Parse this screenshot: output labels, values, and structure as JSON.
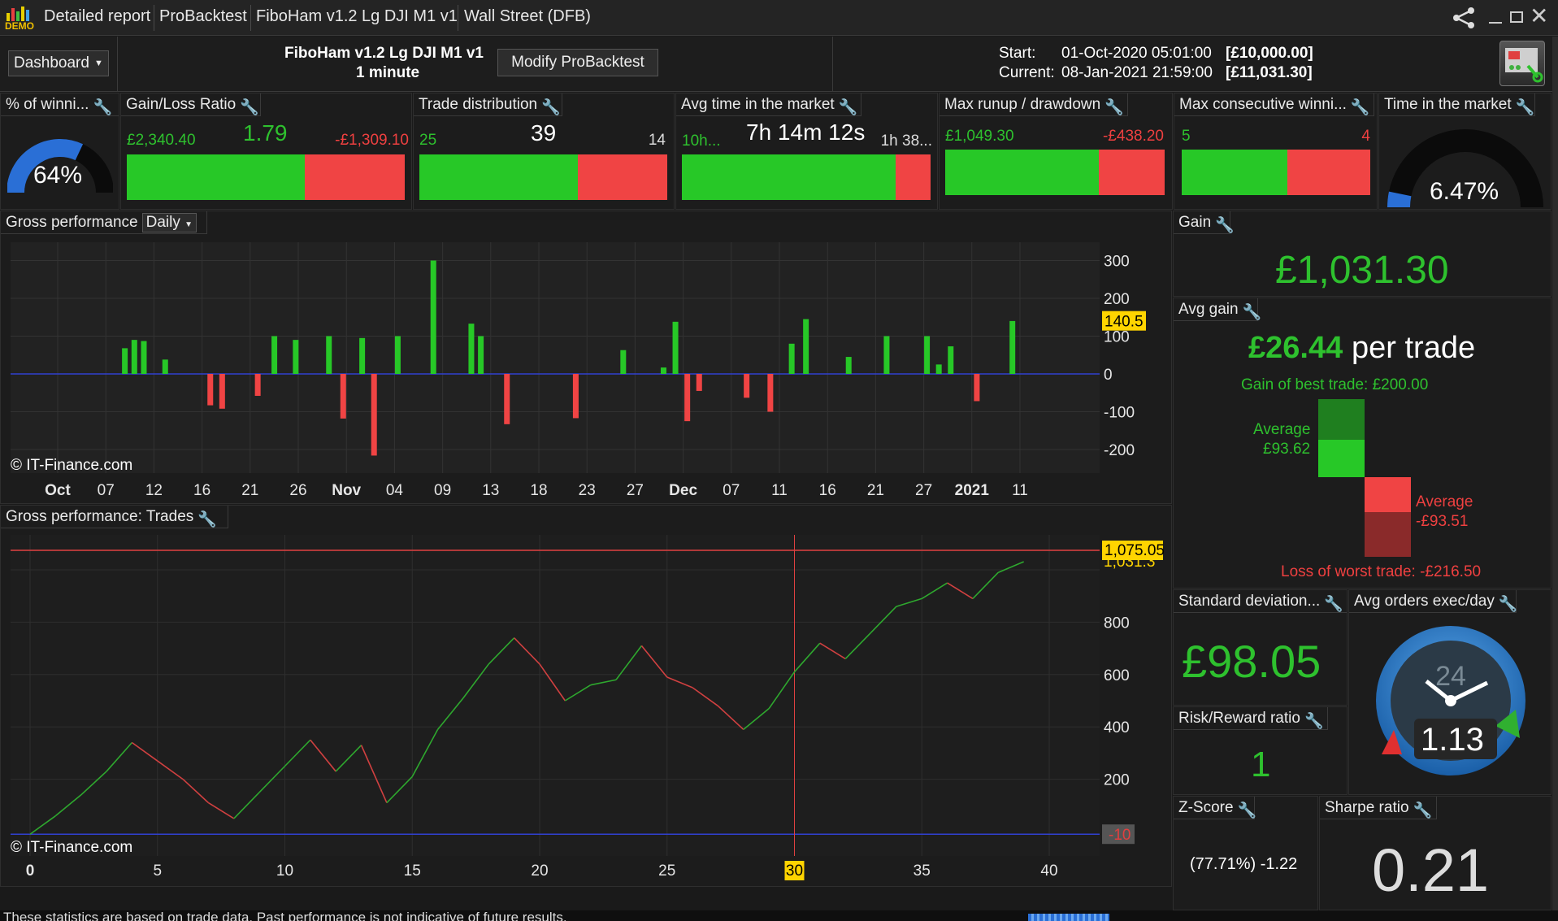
{
  "titlebar": {
    "logo": "DEMO",
    "tabs": [
      "Detailed report",
      "ProBacktest",
      "FiboHam v1.2 Lg DJI M1 v1",
      "Wall Street (DFB)"
    ]
  },
  "header": {
    "dashboard_label": "Dashboard",
    "strategy_name": "FiboHam v1.2 Lg DJI M1 v1",
    "timeframe": "1 minute",
    "modify_button": "Modify ProBacktest",
    "start_label": "Start:",
    "start_date": "01-Oct-2020 05:01:00",
    "start_value": "[£10,000.00]",
    "current_label": "Current:",
    "current_date": "08-Jan-2021 21:59:00",
    "current_value": "[£11,031.30]"
  },
  "kpis": {
    "winning": {
      "title": "% of winni...",
      "value": "64%",
      "fraction": 0.64
    },
    "gain_loss": {
      "title": "Gain/Loss Ratio",
      "gain": "£2,340.40",
      "ratio": "1.79",
      "loss": "-£1,309.10",
      "green_fraction": 0.64
    },
    "trade_dist": {
      "title": "Trade distribution",
      "win": "25",
      "total": "39",
      "loss": "14",
      "green_fraction": 0.64
    },
    "avg_time": {
      "title": "Avg time in the market",
      "win": "10h...",
      "value": "7h 14m 12s",
      "loss": "1h 38...",
      "green_fraction": 0.86
    },
    "runup": {
      "title": "Max runup / drawdown",
      "runup": "£1,049.30",
      "drawdown": "-£438.20",
      "green_fraction": 0.7
    },
    "consec": {
      "title": "Max consecutive winni...",
      "win": "5",
      "loss": "4",
      "green_fraction": 0.56
    },
    "time_market": {
      "title": "Time in the market",
      "value": "6.47%",
      "fraction": 0.0647
    }
  },
  "daily_chart": {
    "title": "Gross performance",
    "mode": "Daily",
    "copyright": "© IT-Finance.com",
    "marker_label": "140.5",
    "y_ticks": [
      "300",
      "200",
      "100",
      "0",
      "-100",
      "-200"
    ],
    "x_ticks": [
      {
        "label": "Oct",
        "bold": true
      },
      {
        "label": "07",
        "bold": false
      },
      {
        "label": "12",
        "bold": false
      },
      {
        "label": "16",
        "bold": false
      },
      {
        "label": "21",
        "bold": false
      },
      {
        "label": "26",
        "bold": false
      },
      {
        "label": "Nov",
        "bold": true
      },
      {
        "label": "04",
        "bold": false
      },
      {
        "label": "09",
        "bold": false
      },
      {
        "label": "13",
        "bold": false
      },
      {
        "label": "18",
        "bold": false
      },
      {
        "label": "23",
        "bold": false
      },
      {
        "label": "27",
        "bold": false
      },
      {
        "label": "Dec",
        "bold": true
      },
      {
        "label": "07",
        "bold": false
      },
      {
        "label": "11",
        "bold": false
      },
      {
        "label": "16",
        "bold": false
      },
      {
        "label": "21",
        "bold": false
      },
      {
        "label": "27",
        "bold": false
      },
      {
        "label": "2021",
        "bold": true
      },
      {
        "label": "11",
        "bold": false
      }
    ],
    "bars": [
      {
        "i": 3.6,
        "v": 68
      },
      {
        "i": 4.0,
        "v": 90
      },
      {
        "i": 4.4,
        "v": 87
      },
      {
        "i": 5.3,
        "v": 38
      },
      {
        "i": 7.2,
        "v": -83
      },
      {
        "i": 7.7,
        "v": -92
      },
      {
        "i": 9.2,
        "v": -58
      },
      {
        "i": 9.9,
        "v": 100
      },
      {
        "i": 10.8,
        "v": 90
      },
      {
        "i": 12.2,
        "v": 100
      },
      {
        "i": 12.8,
        "v": -118
      },
      {
        "i": 13.6,
        "v": 95
      },
      {
        "i": 14.1,
        "v": -216
      },
      {
        "i": 15.1,
        "v": 100
      },
      {
        "i": 16.6,
        "v": 300
      },
      {
        "i": 18.2,
        "v": 133
      },
      {
        "i": 18.6,
        "v": 100
      },
      {
        "i": 19.7,
        "v": -133
      },
      {
        "i": 22.6,
        "v": -117
      },
      {
        "i": 24.6,
        "v": 63
      },
      {
        "i": 26.3,
        "v": 17
      },
      {
        "i": 26.8,
        "v": 138
      },
      {
        "i": 27.3,
        "v": -125
      },
      {
        "i": 27.8,
        "v": -45
      },
      {
        "i": 29.8,
        "v": -63
      },
      {
        "i": 30.8,
        "v": -100
      },
      {
        "i": 31.7,
        "v": 80
      },
      {
        "i": 32.3,
        "v": 145
      },
      {
        "i": 34.1,
        "v": 45
      },
      {
        "i": 35.7,
        "v": 100
      },
      {
        "i": 37.4,
        "v": 100
      },
      {
        "i": 37.9,
        "v": 25
      },
      {
        "i": 38.4,
        "v": 73
      },
      {
        "i": 39.5,
        "v": -72
      },
      {
        "i": 41.0,
        "v": 140
      }
    ]
  },
  "trades_chart": {
    "title": "Gross performance: Trades",
    "copyright": "© IT-Finance.com",
    "max_label": "1,075.05",
    "current_label": "1,031.3",
    "min_label": "-10",
    "cursor_label": "30",
    "y_ticks": [
      "1,000",
      "800",
      "600",
      "400",
      "200"
    ],
    "x_ticks": [
      "0",
      "5",
      "10",
      "15",
      "20",
      "25",
      "30",
      "35",
      "40"
    ],
    "values": [
      -10,
      60,
      140,
      230,
      340,
      270,
      200,
      110,
      50,
      150,
      250,
      350,
      230,
      330,
      110,
      210,
      390,
      510,
      640,
      740,
      640,
      500,
      560,
      580,
      710,
      590,
      550,
      480,
      390,
      470,
      610,
      720,
      660,
      760,
      860,
      890,
      950,
      890,
      990,
      1031
    ]
  },
  "gain": {
    "title": "Gain",
    "value": "£1,031.30"
  },
  "avg_gain": {
    "title": "Avg gain",
    "value": "£26.44",
    "suffix": "per trade",
    "best_trade": "Gain of best trade: £200.00",
    "avg_win_label": "Average",
    "avg_win_value": "£93.62",
    "avg_loss_label": "Average",
    "avg_loss_value": "-£93.51",
    "worst_trade": "Loss of worst trade: -£216.50"
  },
  "std_dev": {
    "title": "Standard deviation...",
    "value": "£98.05"
  },
  "avg_orders": {
    "title": "Avg orders exec/day",
    "value": "1.13",
    "dial_number": "24"
  },
  "risk_reward": {
    "title": "Risk/Reward ratio",
    "value": "1"
  },
  "zscore": {
    "title": "Z-Score",
    "value": "(77.71%) -1.22"
  },
  "sharpe": {
    "title": "Sharpe ratio",
    "value": "0.21"
  },
  "status_text": "These statistics are based on trade data. Past performance is not indicative of future results.",
  "colors": {
    "green": "#27c827",
    "red": "#f04444",
    "blue": "#2a6fd6",
    "marker": "#ffd400"
  }
}
